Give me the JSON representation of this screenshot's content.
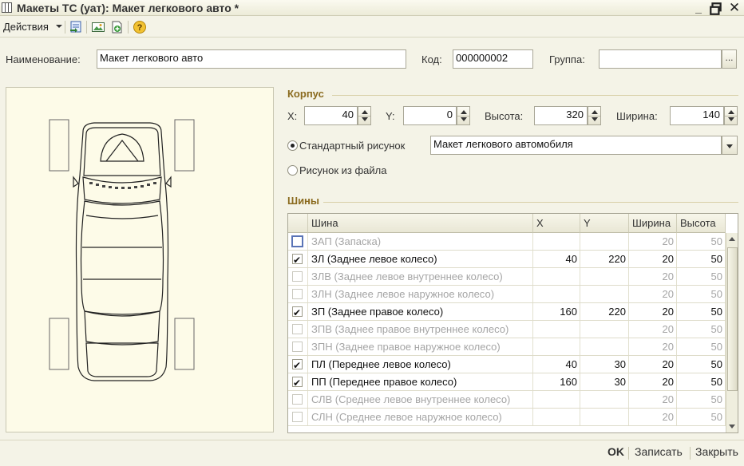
{
  "window": {
    "title": "Макеты ТС (уат): Макет легкового авто *",
    "controls": [
      "minimize-icon",
      "maximize-icon",
      "close-icon"
    ]
  },
  "toolbar": {
    "actions_label": "Действия",
    "icons": [
      "copy-to-form-icon",
      "picture-icon",
      "add-file-icon",
      "help-icon"
    ]
  },
  "header": {
    "name_label": "Наименование:",
    "name_value": "Макет легкового авто",
    "code_label": "Код:",
    "code_value": "000000002",
    "group_label": "Группа:",
    "group_value": "",
    "group_button": "..."
  },
  "body": {
    "section_title": "Корпус",
    "x_label": "X:",
    "x_value": "40",
    "y_label": "Y:",
    "y_value": "0",
    "height_label": "Высота:",
    "height_value": "320",
    "width_label": "Ширина:",
    "width_value": "140",
    "standard_picture_label": "Стандартный рисунок",
    "standard_picture_value": "Макет легкового автомобиля",
    "from_file_label": "Рисунок из файла",
    "picture_mode": "standard"
  },
  "tires": {
    "section_title": "Шины",
    "columns": [
      "Шина",
      "X",
      "Y",
      "Ширина",
      "Высота"
    ],
    "rows": [
      {
        "checked": false,
        "enabled": false,
        "name": "ЗАП (Запаска)",
        "x": "",
        "y": "",
        "width": "20",
        "height": "50"
      },
      {
        "checked": true,
        "enabled": true,
        "name": "ЗЛ (Заднее левое колесо)",
        "x": "40",
        "y": "220",
        "width": "20",
        "height": "50"
      },
      {
        "checked": false,
        "enabled": false,
        "name": "ЗЛВ (Заднее левое внутреннее колесо)",
        "x": "",
        "y": "",
        "width": "20",
        "height": "50"
      },
      {
        "checked": false,
        "enabled": false,
        "name": "ЗЛН (Заднее левое наружное колесо)",
        "x": "",
        "y": "",
        "width": "20",
        "height": "50"
      },
      {
        "checked": true,
        "enabled": true,
        "name": "ЗП (Заднее правое колесо)",
        "x": "160",
        "y": "220",
        "width": "20",
        "height": "50"
      },
      {
        "checked": false,
        "enabled": false,
        "name": "ЗПВ (Заднее правое внутреннее колесо)",
        "x": "",
        "y": "",
        "width": "20",
        "height": "50"
      },
      {
        "checked": false,
        "enabled": false,
        "name": "ЗПН (Заднее правое наружное колесо)",
        "x": "",
        "y": "",
        "width": "20",
        "height": "50"
      },
      {
        "checked": true,
        "enabled": true,
        "name": "ПЛ (Переднее левое колесо)",
        "x": "40",
        "y": "30",
        "width": "20",
        "height": "50"
      },
      {
        "checked": true,
        "enabled": true,
        "name": "ПП (Переднее правое колесо)",
        "x": "160",
        "y": "30",
        "width": "20",
        "height": "50"
      },
      {
        "checked": false,
        "enabled": false,
        "name": "СЛВ (Среднее левое внутреннее колесо)",
        "x": "",
        "y": "",
        "width": "20",
        "height": "50"
      },
      {
        "checked": false,
        "enabled": false,
        "name": "СЛН (Среднее левое наружное колесо)",
        "x": "",
        "y": "",
        "width": "20",
        "height": "50"
      }
    ]
  },
  "footer": {
    "ok_label": "OK",
    "save_label": "Записать",
    "close_label": "Закрыть"
  },
  "colors": {
    "section_title": "#8a6a1e",
    "background": "#f4f3e7",
    "disabled_text": "#a5a5a5"
  }
}
